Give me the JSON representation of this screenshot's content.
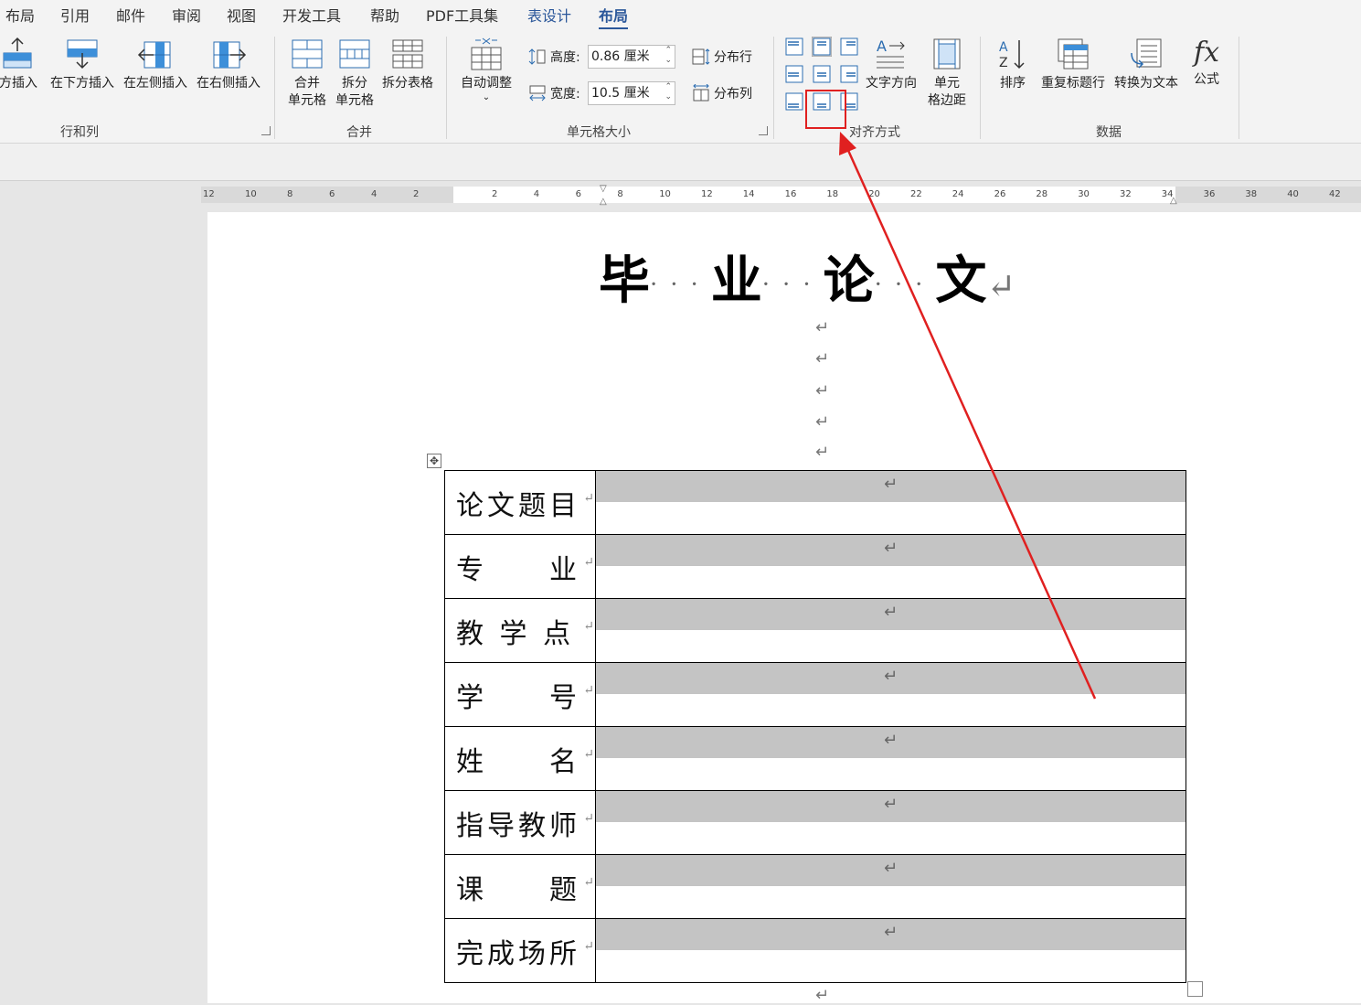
{
  "tabs": [
    {
      "label": "布局",
      "state": "normal"
    },
    {
      "label": "引用",
      "state": "normal"
    },
    {
      "label": "邮件",
      "state": "normal"
    },
    {
      "label": "审阅",
      "state": "normal"
    },
    {
      "label": "视图",
      "state": "normal"
    },
    {
      "label": "开发工具",
      "state": "normal"
    },
    {
      "label": "帮助",
      "state": "normal"
    },
    {
      "label": "PDF工具集",
      "state": "normal"
    },
    {
      "label": "表设计",
      "state": "contextual"
    },
    {
      "label": "布局",
      "state": "active"
    }
  ],
  "ribbon": {
    "rows_cols": {
      "group_label": "行和列",
      "insert_above": "方插入",
      "insert_below": "在下方插入",
      "insert_left": "在左侧插入",
      "insert_right": "在右侧插入"
    },
    "merge": {
      "group_label": "合并",
      "merge_cells_l1": "合并",
      "merge_cells_l2": "单元格",
      "split_cells_l1": "拆分",
      "split_cells_l2": "单元格",
      "split_table": "拆分表格"
    },
    "cell_size": {
      "group_label": "单元格大小",
      "autofit": "自动调整",
      "height_label": "高度:",
      "height_value": "0.86 厘米",
      "width_label": "宽度:",
      "width_value": "10.5 厘米",
      "distribute_rows": "分布行",
      "distribute_cols": "分布列"
    },
    "alignment": {
      "group_label": "对齐方式",
      "text_direction": "文字方向",
      "cell_margins_l1": "单元",
      "cell_margins_l2": "格边距",
      "selected_index": 1
    },
    "data": {
      "group_label": "数据",
      "sort": "排序",
      "repeat_header": "重复标题行",
      "convert_text": "转换为文本",
      "formula": "公式",
      "formula_glyph": "fx"
    }
  },
  "ruler": {
    "left_numbers": [
      "12",
      "10",
      "8",
      "6",
      "4",
      "2"
    ],
    "right_numbers": [
      "2",
      "4",
      "6",
      "8",
      "10",
      "12",
      "14",
      "16",
      "18",
      "20",
      "22",
      "24",
      "26",
      "28",
      "30",
      "32",
      "34",
      "36",
      "38",
      "40",
      "42"
    ]
  },
  "document": {
    "title_chars": [
      "毕",
      "业",
      "论",
      "文"
    ],
    "title_dots": "···",
    "paragraph_mark": "↵",
    "table_move_glyph": "✥",
    "table_rows": [
      {
        "label": "论文题目"
      },
      {
        "label": "专　　业"
      },
      {
        "label": "教 学 点"
      },
      {
        "label": "学　　号"
      },
      {
        "label": "姓　　名"
      },
      {
        "label": "指导教师"
      },
      {
        "label": "课　　题"
      },
      {
        "label": "完成场所"
      }
    ]
  },
  "annotation": {
    "color": "#e02020"
  }
}
